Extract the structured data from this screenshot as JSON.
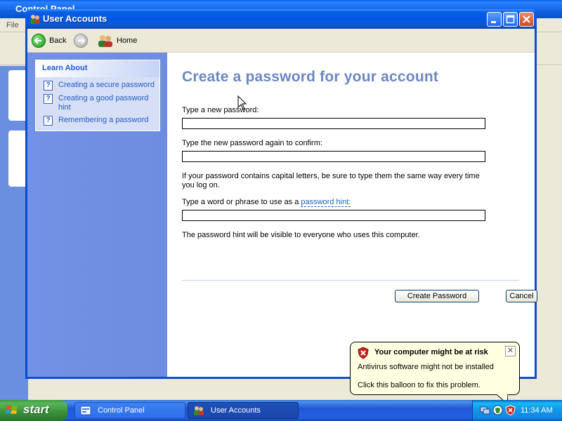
{
  "background_window": {
    "title": "Control Panel",
    "menu_first": "File"
  },
  "window": {
    "title": "User Accounts"
  },
  "nav": {
    "back_label": "Back",
    "home_label": "Home"
  },
  "sidebar": {
    "header": "Learn About",
    "items": [
      {
        "label": "Creating a secure password"
      },
      {
        "label": "Creating a good password hint"
      },
      {
        "label": "Remembering a password"
      }
    ]
  },
  "content": {
    "title": "Create a password for your account",
    "new_password_label": "Type a new password:",
    "confirm_label": "Type the new password again to confirm:",
    "caps_note": "If your password contains capital letters, be sure to type them the same way every time you log on.",
    "hint_label_prefix": "Type a word or phrase to use as a ",
    "hint_label_link": "password hint:",
    "hint_note": "The password hint will be visible to everyone who uses this computer.",
    "new_password_value": "",
    "confirm_value": "",
    "hint_value": "",
    "create_button": "Create Password",
    "cancel_button": "Cancel"
  },
  "balloon": {
    "title": "Your computer might be at risk",
    "message": "Antivirus software might not be installed",
    "action": "Click this balloon to fix this problem.",
    "close_glyph": "✕"
  },
  "taskbar": {
    "start_label": "start",
    "tasks": [
      {
        "label": "Control Panel",
        "active": false
      },
      {
        "label": "User Accounts",
        "active": true
      }
    ],
    "clock": "11:34 AM"
  },
  "colors": {
    "title_bar": "#0a5fe3",
    "sidebar": "#7391e6",
    "link": "#215dc6",
    "page_title": "#6b87c4",
    "balloon_bg": "#ffffe1",
    "start_green": "#3a8f3a"
  }
}
